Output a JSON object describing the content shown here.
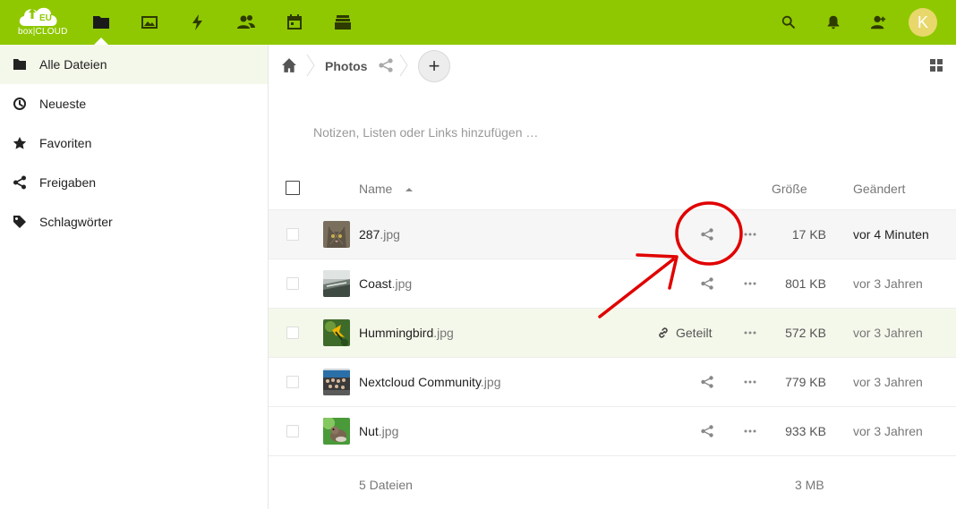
{
  "header": {
    "logo_text": "box|CLOUD",
    "logo_badge": "EU",
    "apps": [
      {
        "icon": "folder-icon",
        "label": "Dateien"
      },
      {
        "icon": "image-icon",
        "label": "Fotos"
      },
      {
        "icon": "activity-icon",
        "label": "Aktivität"
      },
      {
        "icon": "contacts-icon",
        "label": "Kontakte"
      },
      {
        "icon": "calendar-icon",
        "label": "Kalender"
      },
      {
        "icon": "deck-icon",
        "label": "Deck"
      }
    ],
    "avatar_initial": "K"
  },
  "sidebar": {
    "items": [
      {
        "label": "Alle Dateien",
        "icon": "folder-icon",
        "active": true
      },
      {
        "label": "Neueste",
        "icon": "clock-icon"
      },
      {
        "label": "Favoriten",
        "icon": "star-icon"
      },
      {
        "label": "Freigaben",
        "icon": "share-icon"
      },
      {
        "label": "Schlagwörter",
        "icon": "tag-icon"
      }
    ]
  },
  "breadcrumb": {
    "current": "Photos",
    "add_symbol": "+"
  },
  "notes_placeholder": "Notizen, Listen oder Links hinzufügen …",
  "table": {
    "headers": {
      "name": "Name",
      "size": "Größe",
      "modified": "Geändert"
    },
    "rows": [
      {
        "base": "287",
        "ext": ".jpg",
        "size": "17 KB",
        "modified": "vor 4 Minuten",
        "shared": false,
        "state": "hover"
      },
      {
        "base": "Coast",
        "ext": ".jpg",
        "size": "801 KB",
        "modified": "vor 3 Jahren",
        "shared": false,
        "state": "normal"
      },
      {
        "base": "Hummingbird",
        "ext": ".jpg",
        "size": "572 KB",
        "modified": "vor 3 Jahren",
        "shared": true,
        "shared_label": "Geteilt",
        "state": "selected"
      },
      {
        "base": "Nextcloud Community",
        "ext": ".jpg",
        "size": "779 KB",
        "modified": "vor 3 Jahren",
        "shared": false,
        "state": "normal"
      },
      {
        "base": "Nut",
        "ext": ".jpg",
        "size": "933 KB",
        "modified": "vor 3 Jahren",
        "shared": false,
        "state": "normal"
      }
    ],
    "summary": {
      "count": "5 Dateien",
      "total": "3 MB"
    }
  },
  "colors": {
    "brand": "#8fc800",
    "annotation": "#e00000"
  }
}
